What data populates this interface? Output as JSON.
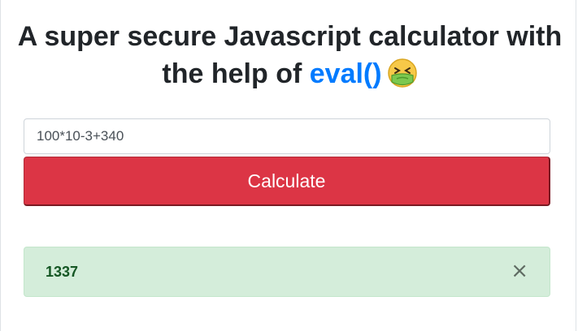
{
  "header": {
    "title_line1": "A super secure Javascript calculator with",
    "title_prefix": "the help of ",
    "title_accent": "eval()",
    "emoji": "nauseated-face-emoji"
  },
  "calculator": {
    "input_value": "100*10-3+340",
    "button_label": "Calculate"
  },
  "result": {
    "value": "1337",
    "close_label": "×"
  },
  "colors": {
    "accent": "#007bff",
    "danger": "#dc3545",
    "success_bg": "#d4edda",
    "success_text": "#155724"
  }
}
